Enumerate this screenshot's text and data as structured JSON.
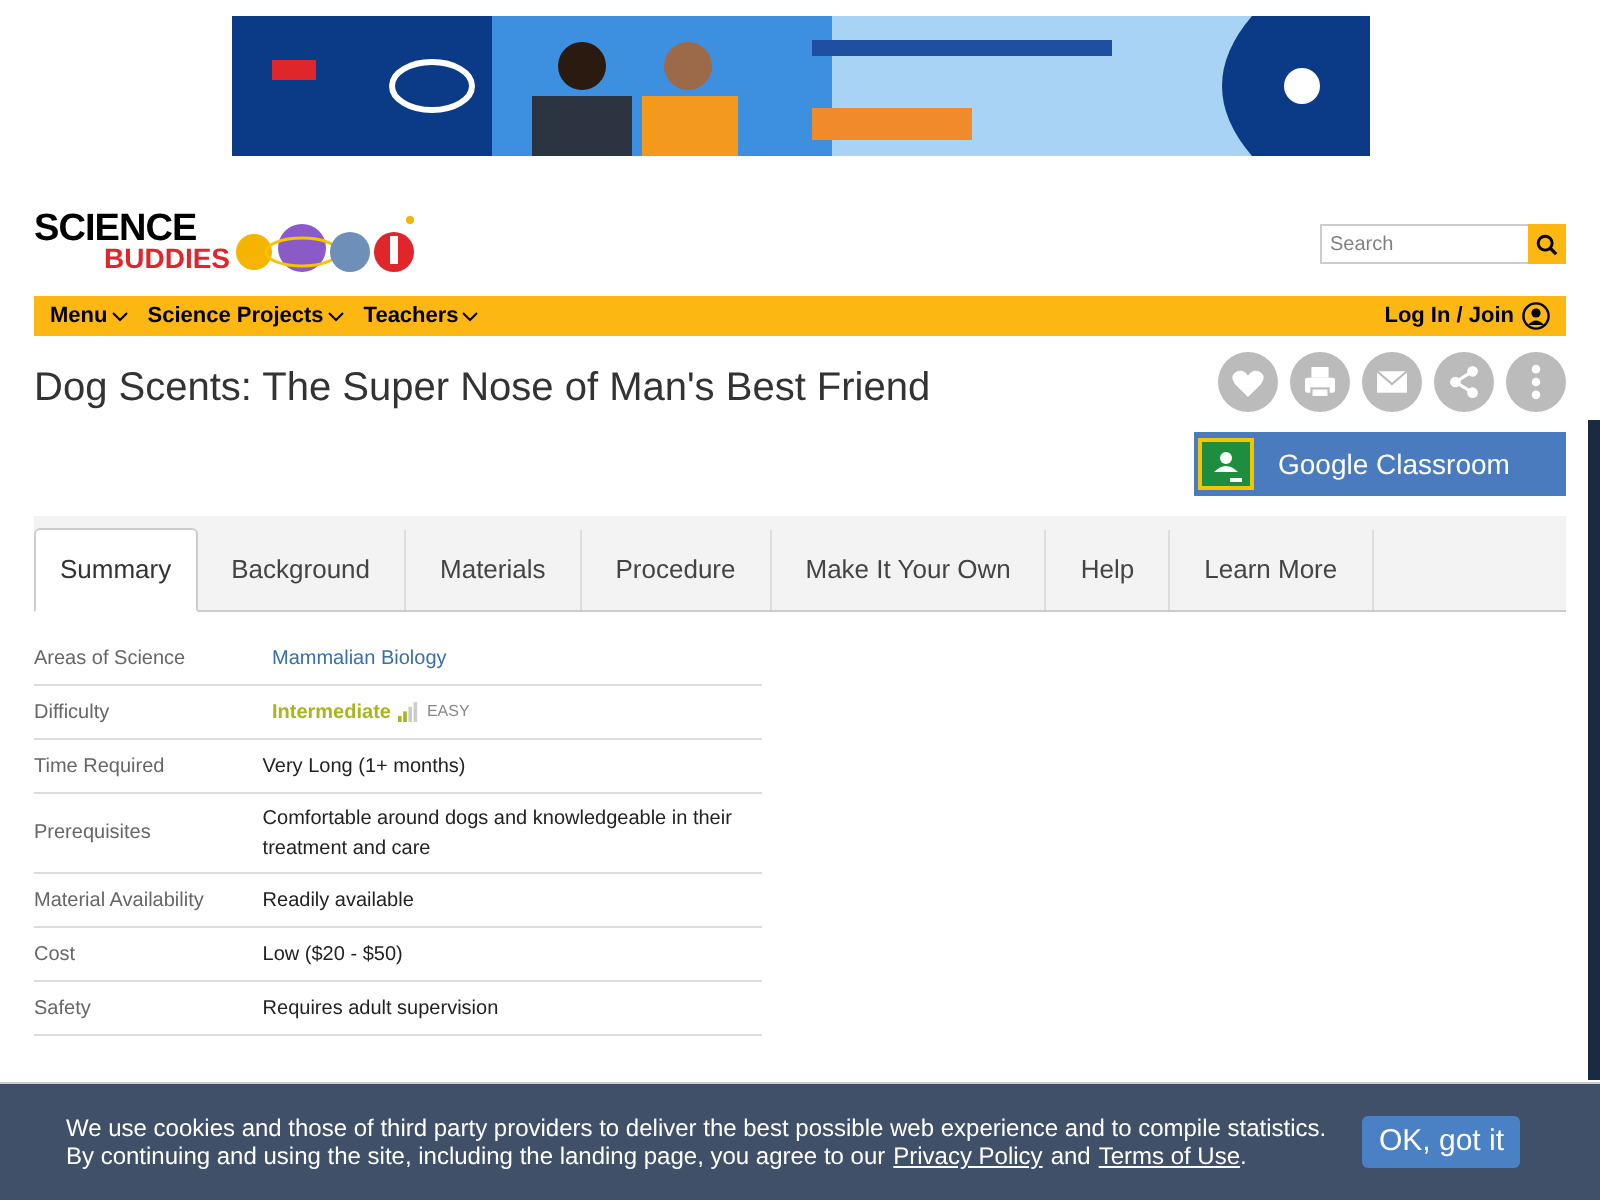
{
  "logo": {
    "line_1": "SCIENCE",
    "line_2": "BUDDIES"
  },
  "search": {
    "placeholder": "Search"
  },
  "nav": {
    "items": [
      {
        "label": "Menu"
      },
      {
        "label": "Science Projects"
      },
      {
        "label": "Teachers"
      }
    ],
    "login": "Log In / Join"
  },
  "title": "Dog Scents: The Super Nose of Man's Best Friend",
  "share_buttons": [
    {
      "kind": "favorite"
    },
    {
      "kind": "print"
    },
    {
      "kind": "email"
    },
    {
      "kind": "share"
    },
    {
      "kind": "more"
    }
  ],
  "classroom_button": "Google Classroom",
  "tabs": [
    {
      "label": "Summary",
      "selected": true
    },
    {
      "label": "Background",
      "selected": false
    },
    {
      "label": "Materials",
      "selected": false
    },
    {
      "label": "Procedure",
      "selected": false
    },
    {
      "label": "Make It Your Own",
      "selected": false
    },
    {
      "label": "Help",
      "selected": false
    },
    {
      "label": "Learn More",
      "selected": false
    }
  ],
  "summary": [
    {
      "label": "Areas of Science",
      "kind": "link",
      "value": "Mammalian Biology"
    },
    {
      "label": "Difficulty",
      "kind": "difficulty",
      "value": "Intermediate",
      "level": 0.5,
      "note": "EASY"
    },
    {
      "label": "Time Required",
      "kind": "text",
      "value": "Very Long (1+ months)"
    },
    {
      "label": "Prerequisites",
      "kind": "text",
      "value": "Comfortable around dogs and knowledgeable in their treatment and care"
    },
    {
      "label": "Material Availability",
      "kind": "text",
      "value": "Readily available"
    },
    {
      "label": "Cost",
      "kind": "text",
      "value": "Low ($20 - $50)"
    },
    {
      "label": "Safety",
      "kind": "text",
      "value": "Requires adult supervision"
    }
  ],
  "cookie_bar": {
    "line_1": "We use cookies and those of third party providers to deliver the best possible web experience and to compile statistics.",
    "line_2_start": "By continuing and using the site, including the landing page, you agree to our",
    "privacy_link": "Privacy Policy",
    "joiner": "and",
    "terms_link": "Terms of Use",
    "end": ".",
    "button": "OK, got it"
  }
}
